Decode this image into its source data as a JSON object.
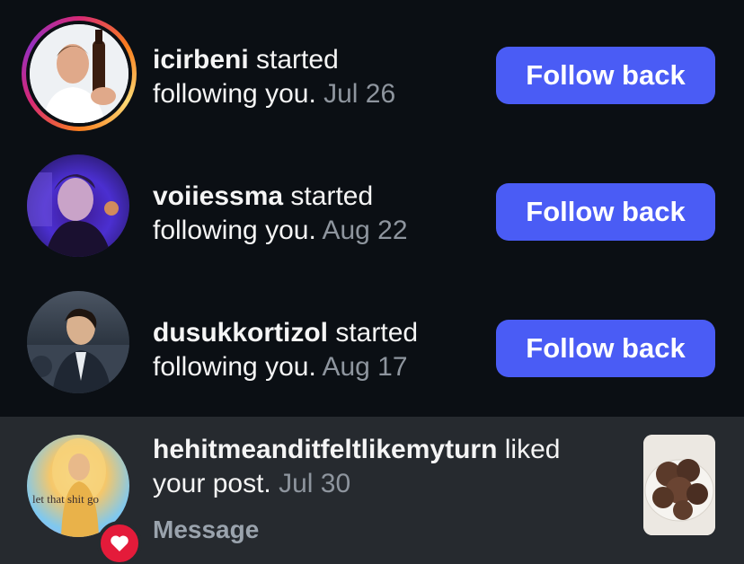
{
  "notifications": [
    {
      "username": "icirbeni",
      "action_line1": " started",
      "action_line2": "following you.",
      "time": "Jul 26",
      "button_label": "Follow back",
      "has_story": true
    },
    {
      "username": "voiiessma",
      "action_line1": " started",
      "action_line2": "following you.",
      "time": "Aug 22",
      "button_label": "Follow back",
      "has_story": false
    },
    {
      "username": "dusukkortizol",
      "action_line1": " started",
      "action_line2": "following you.",
      "time": "Aug 17",
      "button_label": "Follow back",
      "has_story": false
    }
  ],
  "liked": {
    "username": "hehitmeanditfeltlikemyturn",
    "action_line1": " liked",
    "action_line2": "your post.",
    "time": "Jul 30",
    "message_label": "Message",
    "avatar_caption": "let that shit go"
  },
  "colors": {
    "background": "#0b0f14",
    "highlight_row": "#262a2f",
    "button": "#4a5cf5",
    "muted_text": "#8e959e",
    "like_badge": "#e41b3a"
  },
  "icons": {
    "like_badge": "heart-icon"
  }
}
